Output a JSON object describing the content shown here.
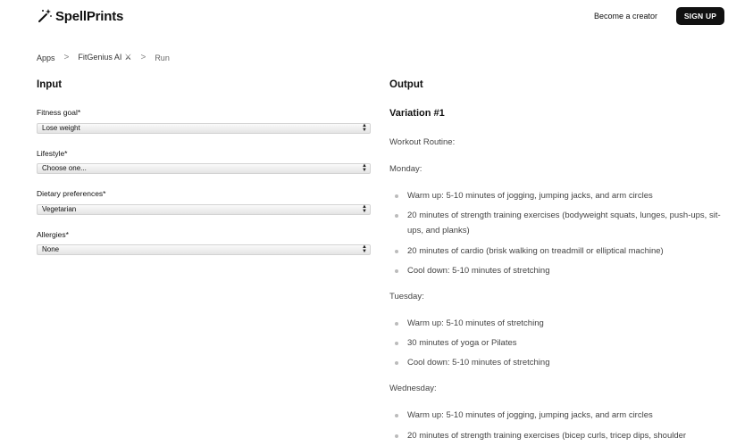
{
  "header": {
    "logo_text": "SpellPrints",
    "creator_link": "Become a creator",
    "signup_label": "SIGN UP"
  },
  "breadcrumb": {
    "apps": "Apps",
    "app_name": "FitGenius AI",
    "current": "Run",
    "separator": ">"
  },
  "input": {
    "title": "Input",
    "fields": [
      {
        "label": "Fitness goal*",
        "value": "Lose weight"
      },
      {
        "label": "Lifestyle*",
        "value": "Choose one..."
      },
      {
        "label": "Dietary preferences*",
        "value": "Vegetarian"
      },
      {
        "label": "Allergies*",
        "value": "None"
      }
    ]
  },
  "output": {
    "title": "Output",
    "variation": "Variation #1",
    "intro": "Workout Routine:",
    "days": [
      {
        "day": "Monday:",
        "items": [
          "Warm up: 5-10 minutes of jogging, jumping jacks, and arm circles",
          "20 minutes of strength training exercises (bodyweight squats, lunges, push-ups, sit-ups, and planks)",
          "20 minutes of cardio (brisk walking on treadmill or elliptical machine)",
          "Cool down: 5-10 minutes of stretching"
        ]
      },
      {
        "day": "Tuesday:",
        "items": [
          "Warm up: 5-10 minutes of stretching",
          "30 minutes of yoga or Pilates",
          "Cool down: 5-10 minutes of stretching"
        ]
      },
      {
        "day": "Wednesday:",
        "items": [
          "Warm up: 5-10 minutes of jogging, jumping jacks, and arm circles",
          "20 minutes of strength training exercises (bicep curls, tricep dips, shoulder"
        ]
      }
    ]
  }
}
